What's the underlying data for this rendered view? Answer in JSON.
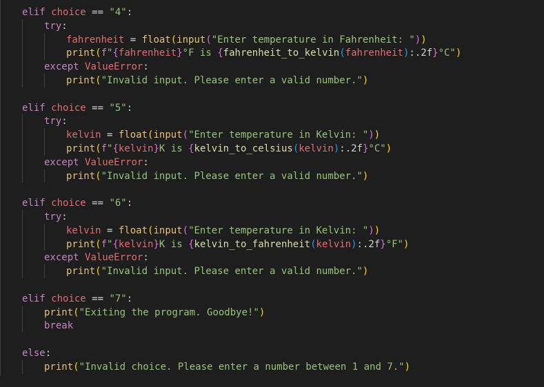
{
  "editor": {
    "colors": {
      "background": "#1e1e1e",
      "keyword": "#c586c0",
      "variable": "#e06c75",
      "function": "#e5c07b",
      "string": "#98c379",
      "operator": "#d4d4d4",
      "bracket_gold": "#ffd700",
      "bracket_orchid": "#da70d6",
      "bracket_blue": "#179fff"
    },
    "lines": [
      {
        "indent": 0,
        "tokens": [
          {
            "t": "kw",
            "v": "elif "
          },
          {
            "t": "var",
            "v": "choice"
          },
          {
            "t": "op",
            "v": " == "
          },
          {
            "t": "str",
            "v": "\"4\""
          },
          {
            "t": "op",
            "v": ":"
          }
        ]
      },
      {
        "indent": 1,
        "tokens": [
          {
            "t": "kw",
            "v": "try"
          },
          {
            "t": "op",
            "v": ":"
          }
        ]
      },
      {
        "indent": 2,
        "tokens": [
          {
            "t": "var",
            "v": "fahrenheit"
          },
          {
            "t": "op",
            "v": " = "
          },
          {
            "t": "fn",
            "v": "float"
          },
          {
            "t": "p1",
            "v": "("
          },
          {
            "t": "fn",
            "v": "input"
          },
          {
            "t": "p2",
            "v": "("
          },
          {
            "t": "str",
            "v": "\"Enter temperature in Fahrenheit: \""
          },
          {
            "t": "p2",
            "v": ")"
          },
          {
            "t": "p1",
            "v": ")"
          }
        ]
      },
      {
        "indent": 2,
        "tokens": [
          {
            "t": "fn",
            "v": "print"
          },
          {
            "t": "p1",
            "v": "("
          },
          {
            "t": "kw",
            "v": "f"
          },
          {
            "t": "str",
            "v": "\""
          },
          {
            "t": "p2",
            "v": "{"
          },
          {
            "t": "var",
            "v": "fahrenheit"
          },
          {
            "t": "p2",
            "v": "}"
          },
          {
            "t": "str",
            "v": "°F is "
          },
          {
            "t": "p2",
            "v": "{"
          },
          {
            "t": "fn2",
            "v": "fahrenheit_to_kelvin"
          },
          {
            "t": "p3",
            "v": "("
          },
          {
            "t": "var",
            "v": "fahrenheit"
          },
          {
            "t": "p3",
            "v": ")"
          },
          {
            "t": "op",
            "v": ":.2f"
          },
          {
            "t": "p2",
            "v": "}"
          },
          {
            "t": "str",
            "v": "°C\""
          },
          {
            "t": "p1",
            "v": ")"
          }
        ]
      },
      {
        "indent": 1,
        "tokens": [
          {
            "t": "kw",
            "v": "except "
          },
          {
            "t": "exc",
            "v": "ValueError"
          },
          {
            "t": "op",
            "v": ":"
          }
        ]
      },
      {
        "indent": 2,
        "tokens": [
          {
            "t": "fn",
            "v": "print"
          },
          {
            "t": "p1",
            "v": "("
          },
          {
            "t": "str",
            "v": "\"Invalid input. Please enter a valid number.\""
          },
          {
            "t": "p1",
            "v": ")"
          }
        ]
      },
      {
        "indent": 0,
        "tokens": []
      },
      {
        "indent": 0,
        "tokens": [
          {
            "t": "kw",
            "v": "elif "
          },
          {
            "t": "var",
            "v": "choice"
          },
          {
            "t": "op",
            "v": " == "
          },
          {
            "t": "str",
            "v": "\"5\""
          },
          {
            "t": "op",
            "v": ":"
          }
        ]
      },
      {
        "indent": 1,
        "tokens": [
          {
            "t": "kw",
            "v": "try"
          },
          {
            "t": "op",
            "v": ":"
          }
        ]
      },
      {
        "indent": 2,
        "tokens": [
          {
            "t": "var",
            "v": "kelvin"
          },
          {
            "t": "op",
            "v": " = "
          },
          {
            "t": "fn",
            "v": "float"
          },
          {
            "t": "p1",
            "v": "("
          },
          {
            "t": "fn",
            "v": "input"
          },
          {
            "t": "p2",
            "v": "("
          },
          {
            "t": "str",
            "v": "\"Enter temperature in Kelvin: \""
          },
          {
            "t": "p2",
            "v": ")"
          },
          {
            "t": "p1",
            "v": ")"
          }
        ]
      },
      {
        "indent": 2,
        "tokens": [
          {
            "t": "fn",
            "v": "print"
          },
          {
            "t": "p1",
            "v": "("
          },
          {
            "t": "kw",
            "v": "f"
          },
          {
            "t": "str",
            "v": "\""
          },
          {
            "t": "p2",
            "v": "{"
          },
          {
            "t": "var",
            "v": "kelvin"
          },
          {
            "t": "p2",
            "v": "}"
          },
          {
            "t": "str",
            "v": "K is "
          },
          {
            "t": "p2",
            "v": "{"
          },
          {
            "t": "fn2",
            "v": "kelvin_to_celsius"
          },
          {
            "t": "p3",
            "v": "("
          },
          {
            "t": "var",
            "v": "kelvin"
          },
          {
            "t": "p3",
            "v": ")"
          },
          {
            "t": "op",
            "v": ":.2f"
          },
          {
            "t": "p2",
            "v": "}"
          },
          {
            "t": "str",
            "v": "°C\""
          },
          {
            "t": "p1",
            "v": ")"
          }
        ]
      },
      {
        "indent": 1,
        "tokens": [
          {
            "t": "kw",
            "v": "except "
          },
          {
            "t": "exc",
            "v": "ValueError"
          },
          {
            "t": "op",
            "v": ":"
          }
        ]
      },
      {
        "indent": 2,
        "tokens": [
          {
            "t": "fn",
            "v": "print"
          },
          {
            "t": "p1",
            "v": "("
          },
          {
            "t": "str",
            "v": "\"Invalid input. Please enter a valid number.\""
          },
          {
            "t": "p1",
            "v": ")"
          }
        ]
      },
      {
        "indent": 0,
        "tokens": []
      },
      {
        "indent": 0,
        "tokens": [
          {
            "t": "kw",
            "v": "elif "
          },
          {
            "t": "var",
            "v": "choice"
          },
          {
            "t": "op",
            "v": " == "
          },
          {
            "t": "str",
            "v": "\"6\""
          },
          {
            "t": "op",
            "v": ":"
          }
        ]
      },
      {
        "indent": 1,
        "tokens": [
          {
            "t": "kw",
            "v": "try"
          },
          {
            "t": "op",
            "v": ":"
          }
        ]
      },
      {
        "indent": 2,
        "tokens": [
          {
            "t": "var",
            "v": "kelvin"
          },
          {
            "t": "op",
            "v": " = "
          },
          {
            "t": "fn",
            "v": "float"
          },
          {
            "t": "p1",
            "v": "("
          },
          {
            "t": "fn",
            "v": "input"
          },
          {
            "t": "p2",
            "v": "("
          },
          {
            "t": "str",
            "v": "\"Enter temperature in Kelvin: \""
          },
          {
            "t": "p2",
            "v": ")"
          },
          {
            "t": "p1",
            "v": ")"
          }
        ]
      },
      {
        "indent": 2,
        "tokens": [
          {
            "t": "fn",
            "v": "print"
          },
          {
            "t": "p1",
            "v": "("
          },
          {
            "t": "kw",
            "v": "f"
          },
          {
            "t": "str",
            "v": "\""
          },
          {
            "t": "p2",
            "v": "{"
          },
          {
            "t": "var",
            "v": "kelvin"
          },
          {
            "t": "p2",
            "v": "}"
          },
          {
            "t": "str",
            "v": "K is "
          },
          {
            "t": "p2",
            "v": "{"
          },
          {
            "t": "fn2",
            "v": "kelvin_to_fahrenheit"
          },
          {
            "t": "p3",
            "v": "("
          },
          {
            "t": "var",
            "v": "kelvin"
          },
          {
            "t": "p3",
            "v": ")"
          },
          {
            "t": "op",
            "v": ":.2f"
          },
          {
            "t": "p2",
            "v": "}"
          },
          {
            "t": "str",
            "v": "°F\""
          },
          {
            "t": "p1",
            "v": ")"
          }
        ]
      },
      {
        "indent": 1,
        "tokens": [
          {
            "t": "kw",
            "v": "except "
          },
          {
            "t": "exc",
            "v": "ValueError"
          },
          {
            "t": "op",
            "v": ":"
          }
        ]
      },
      {
        "indent": 2,
        "tokens": [
          {
            "t": "fn",
            "v": "print"
          },
          {
            "t": "p1",
            "v": "("
          },
          {
            "t": "str",
            "v": "\"Invalid input. Please enter a valid number.\""
          },
          {
            "t": "p1",
            "v": ")"
          }
        ]
      },
      {
        "indent": 0,
        "tokens": []
      },
      {
        "indent": 0,
        "tokens": [
          {
            "t": "kw",
            "v": "elif "
          },
          {
            "t": "var",
            "v": "choice"
          },
          {
            "t": "op",
            "v": " == "
          },
          {
            "t": "str",
            "v": "\"7\""
          },
          {
            "t": "op",
            "v": ":"
          }
        ]
      },
      {
        "indent": 1,
        "tokens": [
          {
            "t": "fn",
            "v": "print"
          },
          {
            "t": "p1",
            "v": "("
          },
          {
            "t": "str",
            "v": "\"Exiting the program. Goodbye!\""
          },
          {
            "t": "p1",
            "v": ")"
          }
        ]
      },
      {
        "indent": 1,
        "tokens": [
          {
            "t": "kw",
            "v": "break"
          }
        ]
      },
      {
        "indent": 0,
        "tokens": []
      },
      {
        "indent": 0,
        "tokens": [
          {
            "t": "kw",
            "v": "else"
          },
          {
            "t": "op",
            "v": ":"
          }
        ]
      },
      {
        "indent": 1,
        "tokens": [
          {
            "t": "fn",
            "v": "print"
          },
          {
            "t": "p1",
            "v": "("
          },
          {
            "t": "str",
            "v": "\"Invalid choice. Please enter a number between 1 and 7.\""
          },
          {
            "t": "p1",
            "v": ")"
          }
        ]
      }
    ]
  }
}
